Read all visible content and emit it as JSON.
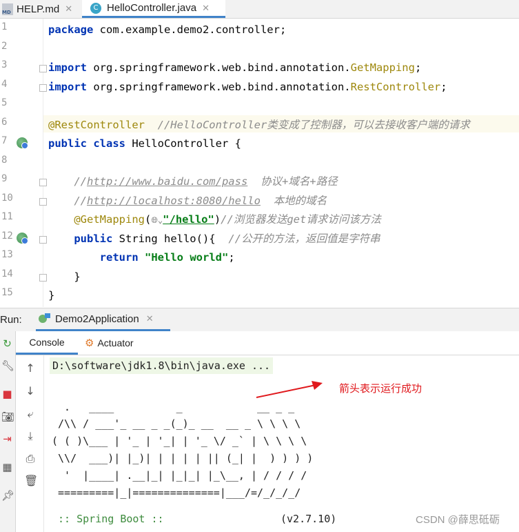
{
  "tabs": [
    {
      "label": "HELP.md",
      "icon": "markdown-icon"
    },
    {
      "label": "HelloController.java",
      "icon": "class-icon"
    }
  ],
  "editor": {
    "line_numbers": [
      "1",
      "2",
      "3",
      "4",
      "5",
      "6",
      "7",
      "8",
      "9",
      "10",
      "11",
      "12",
      "13",
      "14",
      "15"
    ],
    "lines": {
      "l1_kw": "package",
      "l1_rest": " com.example.demo2.controller;",
      "l3_kw": "import",
      "l3_rest": " org.springframework.web.bind.annotation.",
      "l3_ann": "GetMapping",
      "l3_end": ";",
      "l4_kw": "import",
      "l4_rest": " org.springframework.web.bind.annotation.",
      "l4_ann": "RestController",
      "l4_end": ";",
      "l6_ann": "@RestController",
      "l6_cm": "  //HelloController类变成了控制器，可以去接收客户端的请求",
      "l7_kw": "public class",
      "l7_rest": " HelloController {",
      "l9_cm1": "    //",
      "l9_link": "http://www.baidu.com/pass",
      "l9_cm2": "  协议+域名+路径",
      "l10_cm1": "    //",
      "l10_link": "http://localhost:8080/hello",
      "l10_cm2": "  本地的域名",
      "l11_ann": "    @GetMapping",
      "l11_p1": "(",
      "l11_str": "\"/hello\"",
      "l11_p2": ")",
      "l11_cm": "//浏览器发送get请求访问该方法",
      "l12_kw": "    public",
      "l12_rest": " String hello(){  ",
      "l12_cm": "//公开的方法，返回值是字符串",
      "l13_kw": "        return",
      "l13_sp": " ",
      "l13_str": "\"Hello world\"",
      "l13_end": ";",
      "l14": "    }",
      "l15": "}"
    }
  },
  "run": {
    "label": "Run:",
    "config_tab": "Demo2Application"
  },
  "console_tabs": {
    "console": "Console",
    "actuator": "Actuator"
  },
  "console": {
    "command": "D:\\software\\jdk1.8\\bin\\java.exe ...",
    "banner": [
      "  .   ____          _            __ _ _",
      " /\\\\ / ___'_ __ _ _(_)_ __  __ _ \\ \\ \\ \\",
      "( ( )\\___ | '_ | '_| | '_ \\/ _` | \\ \\ \\ \\",
      " \\\\/  ___)| |_)| | | | | || (_| |  ) ) ) )",
      "  '  |____| .__|_| |_|_| |_\\__, | / / / /",
      " =========|_|==============|___/=/_/_/_/"
    ],
    "spring_boot": " :: Spring Boot ::",
    "version": "(v2.7.10)"
  },
  "annotation_note": "箭头表示运行成功",
  "watermark": "CSDN @薛思砥砺",
  "colors": {
    "keyword": "#0033b3",
    "annotation": "#9e880d",
    "comment": "#8c8c8c",
    "string": "#067d17",
    "note_red": "#e0191d",
    "tab_underline": "#4083c9"
  }
}
